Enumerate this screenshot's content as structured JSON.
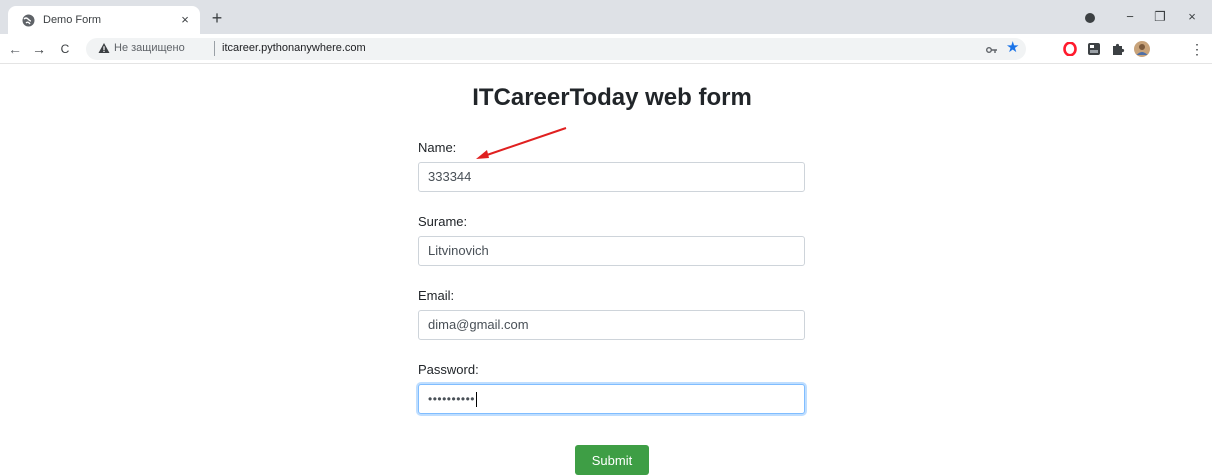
{
  "browser": {
    "tab_title": "Demo Form",
    "tab_close": "×",
    "new_tab": "+",
    "address_insecure_label": "Не защищено",
    "address_url": "itcareer.pythonanywhere.com",
    "nav": {
      "back": "←",
      "forward": "→",
      "reload": "C"
    },
    "window_controls": {
      "minimize": "−",
      "restore": "❐",
      "close": "×"
    },
    "more_menu": "⋮",
    "colors": {
      "star": "#1a73e8",
      "opera": "#ff1b2d"
    }
  },
  "form": {
    "title": "ITCareerToday web form",
    "fields": [
      {
        "label": "Name:",
        "value": "333344"
      },
      {
        "label": "Surame:",
        "value": "Litvinovich"
      },
      {
        "label": "Email:",
        "value": "dima@gmail.com"
      },
      {
        "label": "Password:",
        "value": "••••••••••"
      }
    ],
    "submit_label": "Submit",
    "colors": {
      "submit": "#3e9e45",
      "focus_border": "#80bdff",
      "annotation_arrow": "#e02020"
    }
  }
}
